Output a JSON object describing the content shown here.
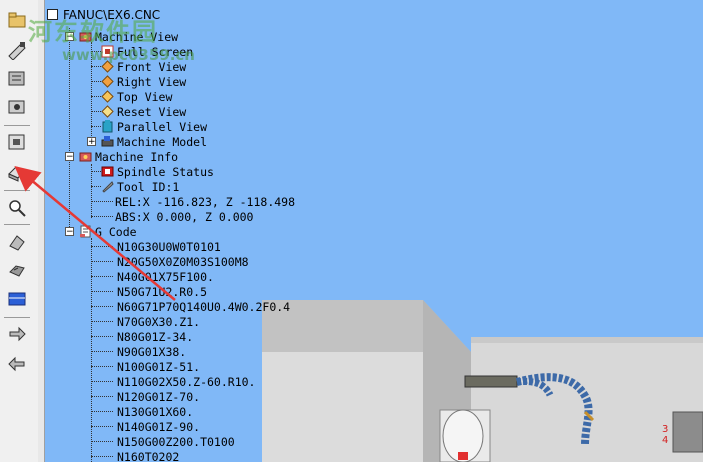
{
  "watermark": {
    "title": "河东软件园",
    "url": "www.pc0359.cn"
  },
  "root": {
    "label": "FANUC\\EX6.CNC"
  },
  "toolbar": {
    "buttons": [
      {
        "name": "open-file-icon"
      },
      {
        "name": "edit-program-icon"
      },
      {
        "name": "book-icon"
      },
      {
        "name": "setup-icon"
      },
      {
        "name": "machine-parts-icon"
      },
      {
        "name": "machine-view-icon"
      },
      {
        "name": "zoom-icon"
      },
      {
        "name": "tool-icon"
      },
      {
        "name": "workpiece-icon"
      },
      {
        "name": "display-icon"
      },
      {
        "name": "step-forward-icon"
      },
      {
        "name": "step-backward-icon"
      }
    ]
  },
  "tree": {
    "machine_view": {
      "label": "Machine View",
      "children": [
        "Full Screen",
        "Front View",
        "Right View",
        "Top View",
        "Reset View",
        "Parallel View",
        "Machine Model"
      ]
    },
    "machine_info": {
      "label": "Machine Info",
      "spindle": "Spindle Status",
      "tool": "Tool ID:1",
      "rel": "REL:X -116.823, Z -118.498",
      "abs": "ABS:X    0.000, Z    0.000"
    },
    "g_code": {
      "label": "G Code",
      "lines": [
        "N10G30U0W0T0101",
        "N20G50X0Z0M03S100M8",
        "N40G01X75F100.",
        "N50G71U2.R0.5",
        "N60G71P70Q140U0.4W0.2F0.4",
        "N70G0X30.Z1.",
        "N80G01Z-34.",
        "N90G01X38.",
        "N100G01Z-51.",
        "N110G02X50.Z-60.R10.",
        "N120G01Z-70.",
        "N130G01X60.",
        "N140G01Z-90.",
        "N150G00Z200.T0100",
        "N160T0202"
      ]
    }
  },
  "scene": {
    "label_a": "3",
    "label_b": "4"
  },
  "colors": {
    "viewport": "#80b8f7",
    "arrow": "#e53935"
  }
}
